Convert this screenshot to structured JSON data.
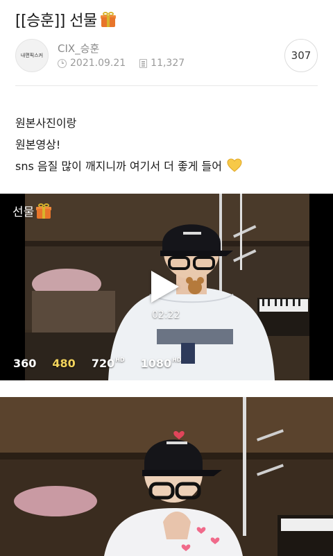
{
  "post": {
    "title": "[[승훈]] 선물",
    "title_emoji": "gift-icon"
  },
  "author": {
    "avatar_text": "내편픽스커",
    "name": "CIX_승훈",
    "date": "2021.09.21",
    "views": "11,327",
    "comments": "307"
  },
  "body": {
    "lines": [
      "원본사진이랑",
      "원본영상!",
      "sns 음질 많이 깨지니까 여기서 더 좋게 들어"
    ],
    "end_emoji": "yellow-heart-icon"
  },
  "video": {
    "tag": "선물",
    "tag_emoji": "gift-icon",
    "duration": "02:22",
    "qualities": [
      {
        "label": "360",
        "badge": "",
        "active": false
      },
      {
        "label": "480",
        "badge": "",
        "active": true
      },
      {
        "label": "720",
        "badge": "HD",
        "active": false
      },
      {
        "label": "1080",
        "badge": "HD",
        "active": false
      }
    ],
    "active_color": "#f2d35c"
  }
}
